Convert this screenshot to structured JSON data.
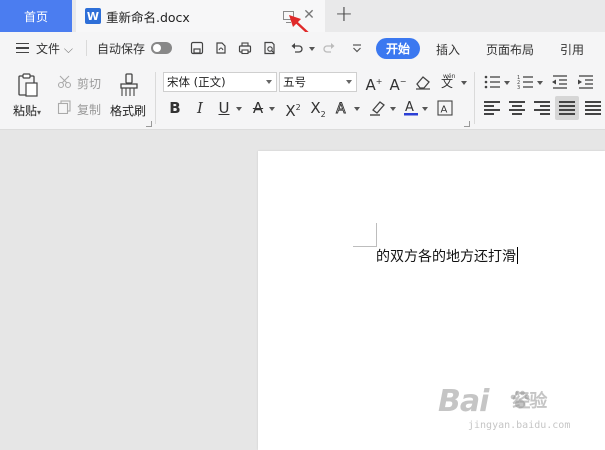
{
  "tabs": {
    "home": "首页",
    "document": "重新命名.docx",
    "doc_icon_letter": "W"
  },
  "menu": {
    "file": "文件",
    "autosave": "自动保存",
    "items": [
      "开始",
      "插入",
      "页面布局",
      "引用"
    ]
  },
  "ribbon": {
    "paste": "粘贴",
    "cut": "剪切",
    "copy": "复制",
    "format_painter": "格式刷",
    "font_name": "宋体 (正文)",
    "font_size": "五号"
  },
  "document": {
    "text": "的双方各的地方还打滑"
  },
  "watermark": {
    "brand": "Bai",
    "brand2": "经验",
    "url": "jingyan.baidu.com"
  },
  "colors": {
    "accent": "#3b78f0",
    "home_tab": "#4b7df0",
    "arrow": "#e02a2a"
  }
}
